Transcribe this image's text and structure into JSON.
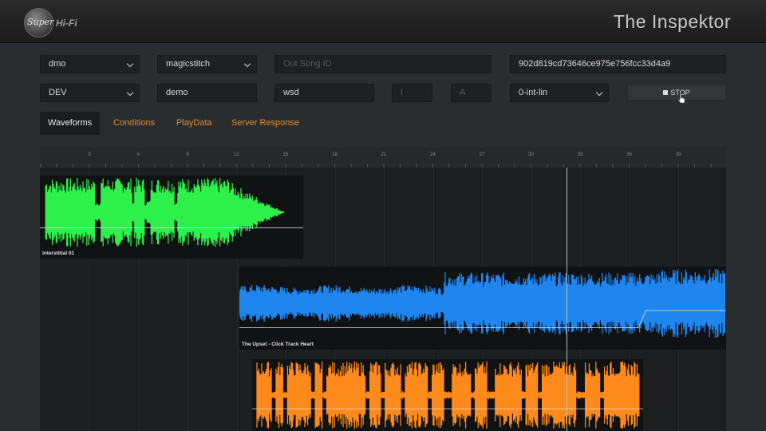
{
  "app": {
    "title": "The Inspektor"
  },
  "logo": {
    "super": "Super",
    "hifi": "Hi-Fi"
  },
  "row1": {
    "env_select": "dmo",
    "profile_select": "magicstitch",
    "out_song_placeholder": "Out Song ID",
    "hash_field": "902d819cd73646ce975e756fcc33d4a9"
  },
  "row2": {
    "stage_select": "DEV",
    "name_field": "demo",
    "station_field": "wsd",
    "i_placeholder": "I",
    "a_placeholder": "A",
    "mode_select": "0-int-lin",
    "stop_label": "STOP"
  },
  "tabs": [
    {
      "label": "Waveforms"
    },
    {
      "label": "Conditions"
    },
    {
      "label": "PlayData"
    },
    {
      "label": "Server Response"
    }
  ],
  "ruler": {
    "ticks": [
      "3",
      "6",
      "9",
      "12",
      "15",
      "18",
      "21",
      "24",
      "27",
      "30",
      "33",
      "36",
      "39"
    ]
  },
  "clips": [
    {
      "name": "Interstitial 01",
      "color": "#2ef04a"
    },
    {
      "name": "The Upset - Click Track Heart",
      "color": "#1f86f0"
    },
    {
      "name": "",
      "color": "#ff8a1c"
    }
  ],
  "colors": {
    "accent": "#e08a2d",
    "background": "#2a2d30"
  }
}
